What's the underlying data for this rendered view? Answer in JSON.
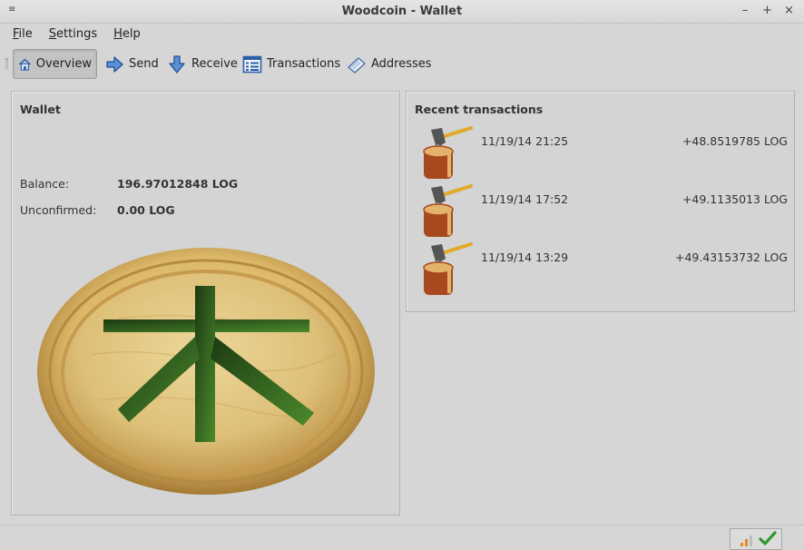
{
  "window": {
    "title": "Woodcoin - Wallet",
    "menu_glyph": "≡",
    "minimize": "–",
    "maximize": "+",
    "close": "×"
  },
  "menu": {
    "items": [
      {
        "label": "File",
        "mnemonic": "F",
        "rest": "ile"
      },
      {
        "label": "Settings",
        "mnemonic": "S",
        "rest": "ettings"
      },
      {
        "label": "Help",
        "mnemonic": "H",
        "rest": "elp"
      }
    ]
  },
  "toolbar": {
    "overview": "Overview",
    "send": "Send",
    "receive": "Receive",
    "transactions": "Transactions",
    "addresses": "Addresses",
    "active": "overview"
  },
  "wallet": {
    "title": "Wallet",
    "balance_label": "Balance:",
    "balance_value": "196.97012848 LOG",
    "unconfirmed_label": "Unconfirmed:",
    "unconfirmed_value": "0.00 LOG",
    "logo_char": "木"
  },
  "recent": {
    "title": "Recent transactions",
    "items": [
      {
        "date": "11/19/14 21:25",
        "amount": "+48.8519785 LOG"
      },
      {
        "date": "11/19/14 17:52",
        "amount": "+49.1135013 LOG"
      },
      {
        "date": "11/19/14 13:29",
        "amount": "+49.43153732 LOG"
      }
    ]
  },
  "status": {
    "sync_icon": "connection-bars-icon",
    "check_icon": "synced-check-icon"
  },
  "colors": {
    "accent_green": "#3a7a1e",
    "wood": "#d9b66a",
    "stump": "#a8481f"
  }
}
